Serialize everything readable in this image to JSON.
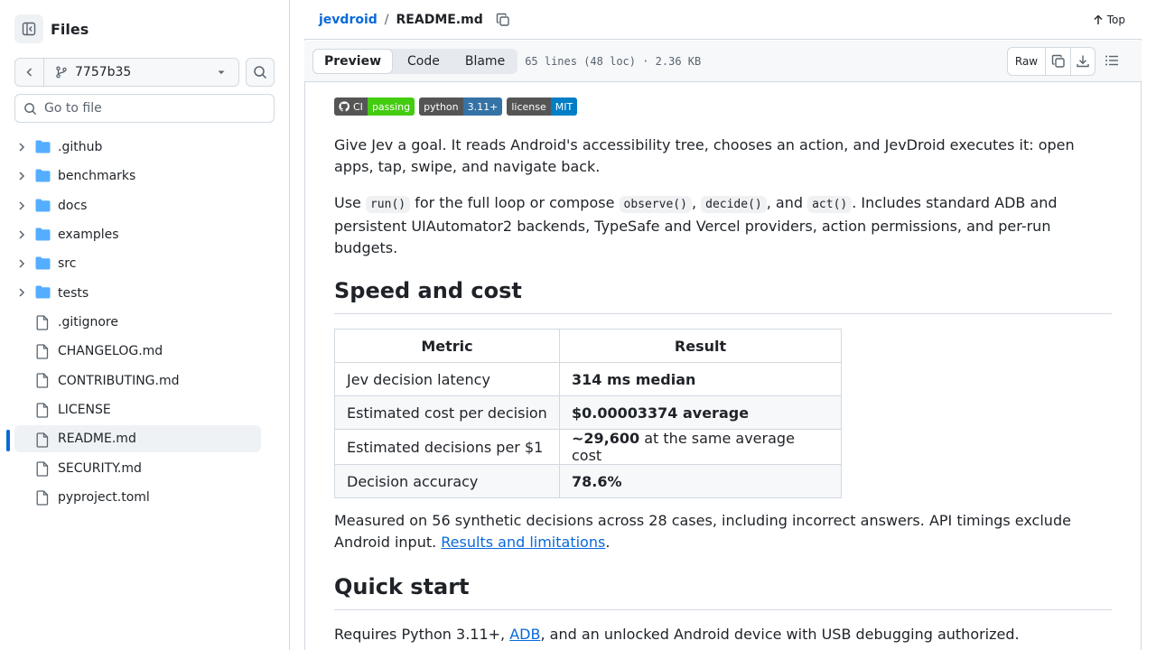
{
  "sidebar": {
    "title": "Files",
    "branch": "7757b35",
    "goto_placeholder": "Go to file",
    "items": [
      {
        "type": "folder",
        "name": ".github"
      },
      {
        "type": "folder",
        "name": "benchmarks"
      },
      {
        "type": "folder",
        "name": "docs"
      },
      {
        "type": "folder",
        "name": "examples"
      },
      {
        "type": "folder",
        "name": "src"
      },
      {
        "type": "folder",
        "name": "tests"
      },
      {
        "type": "file",
        "name": ".gitignore"
      },
      {
        "type": "file",
        "name": "CHANGELOG.md"
      },
      {
        "type": "file",
        "name": "CONTRIBUTING.md"
      },
      {
        "type": "file",
        "name": "LICENSE"
      },
      {
        "type": "file",
        "name": "README.md",
        "active": true
      },
      {
        "type": "file",
        "name": "SECURITY.md"
      },
      {
        "type": "file",
        "name": "pyproject.toml"
      }
    ]
  },
  "header": {
    "repo": "jevdroid",
    "separator": "/",
    "file": "README.md",
    "top_label": "Top"
  },
  "toolbar": {
    "tabs": [
      "Preview",
      "Code",
      "Blame"
    ],
    "active_tab": "Preview",
    "meta": "65 lines (48 loc) · 2.36 KB",
    "raw_label": "Raw"
  },
  "readme": {
    "badges": [
      {
        "left": "CI",
        "right": "passing",
        "color": "#4c1"
      },
      {
        "left": "python",
        "right": "3.11+",
        "color": "#3572A5"
      },
      {
        "left": "license",
        "right": "MIT",
        "color": "#007ec6"
      }
    ],
    "intro": "Give Jev a goal. It reads Android's accessibility tree, chooses an action, and JevDroid executes it: open apps, tap, swipe, and navigate back.",
    "use": {
      "p1": "Use ",
      "c1": "run()",
      "p2": " for the full loop or compose ",
      "c2": "observe()",
      "p3": ", ",
      "c3": "decide()",
      "p4": ", and ",
      "c4": "act()",
      "p5": ". Includes standard ADB and persistent UIAutomator2 backends, TypeSafe and Vercel providers, action permissions, and per-run budgets."
    },
    "h_speed": "Speed and cost",
    "table": {
      "headers": [
        "Metric",
        "Result"
      ],
      "rows": [
        {
          "metric": "Jev decision latency",
          "bold": "314 ms median",
          "rest": ""
        },
        {
          "metric": "Estimated cost per decision",
          "bold": "$0.00003374 average",
          "rest": ""
        },
        {
          "metric": "Estimated decisions per $1",
          "bold": "~29,600",
          "rest": " at the same average cost"
        },
        {
          "metric": "Decision accuracy",
          "bold": "78.6%",
          "rest": ""
        }
      ]
    },
    "measured": {
      "text": "Measured on 56 synthetic decisions across 28 cases, including incorrect answers. API timings exclude Android input. ",
      "link": "Results and limitations",
      "end": "."
    },
    "h_quick": "Quick start",
    "requires": {
      "pre": "Requires Python 3.11+, ",
      "link": "ADB",
      "post": ", and an unlocked Android device with USB debugging authorized."
    }
  },
  "colors": {
    "accent": "#0969da",
    "folder": "#54aeff",
    "border": "#d1d9e0"
  }
}
